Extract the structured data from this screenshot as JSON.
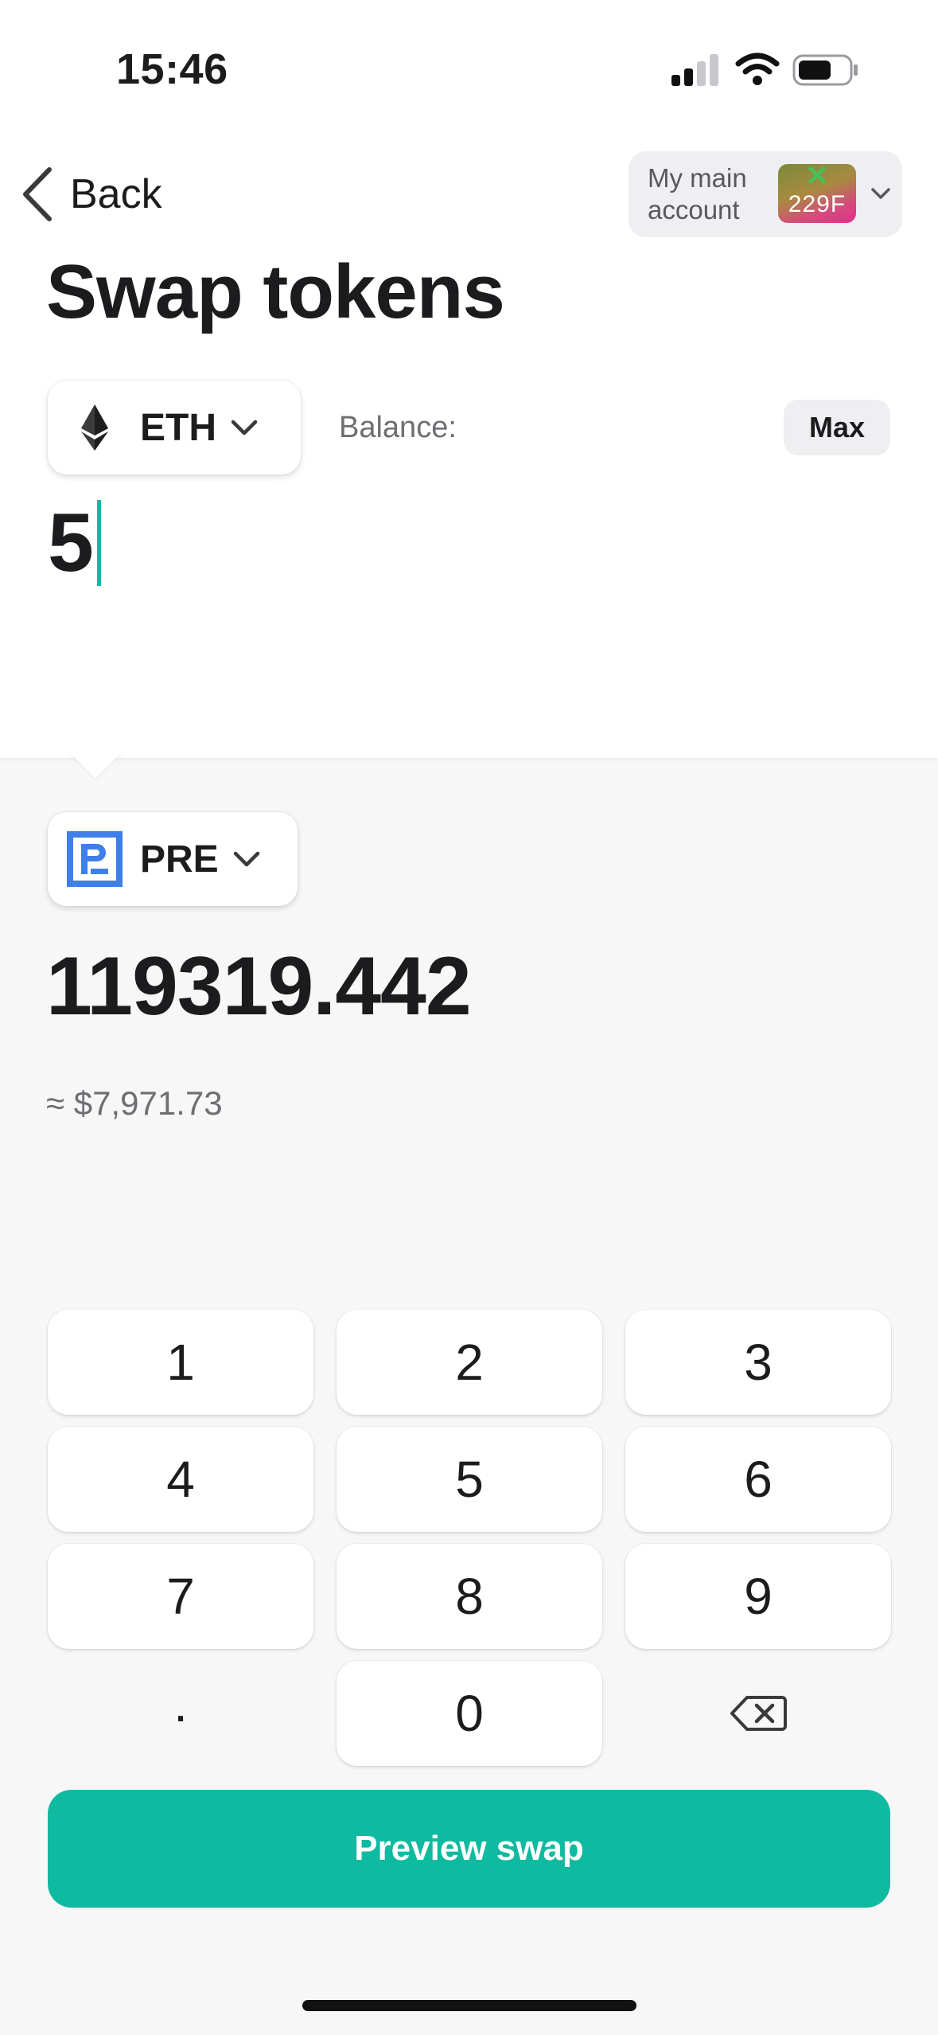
{
  "status_bar": {
    "time": "15:46",
    "icons": [
      "signal-icon",
      "wifi-icon",
      "battery-icon"
    ]
  },
  "nav": {
    "back_label": "Back",
    "account": {
      "name": "My main account",
      "avatar_label": "229F",
      "avatar_mark": "✕"
    }
  },
  "title": "Swap tokens",
  "from": {
    "symbol": "ETH",
    "icon": "ethereum-icon",
    "balance_label": "Balance:",
    "max_label": "Max",
    "amount": "5"
  },
  "to": {
    "symbol": "PRE",
    "icon": "presearch-icon",
    "amount": "119319.442",
    "fiat_value": "≈ $7,971.73"
  },
  "keypad": {
    "keys": [
      "1",
      "2",
      "3",
      "4",
      "5",
      "6",
      "7",
      "8",
      "9",
      ".",
      "0"
    ],
    "backspace_icon": "backspace-icon"
  },
  "action": {
    "label": "Preview swap"
  },
  "colors": {
    "accent": "#0ebaa0",
    "presearch_blue": "#3f7fe8",
    "background": "#f7f7f8"
  }
}
